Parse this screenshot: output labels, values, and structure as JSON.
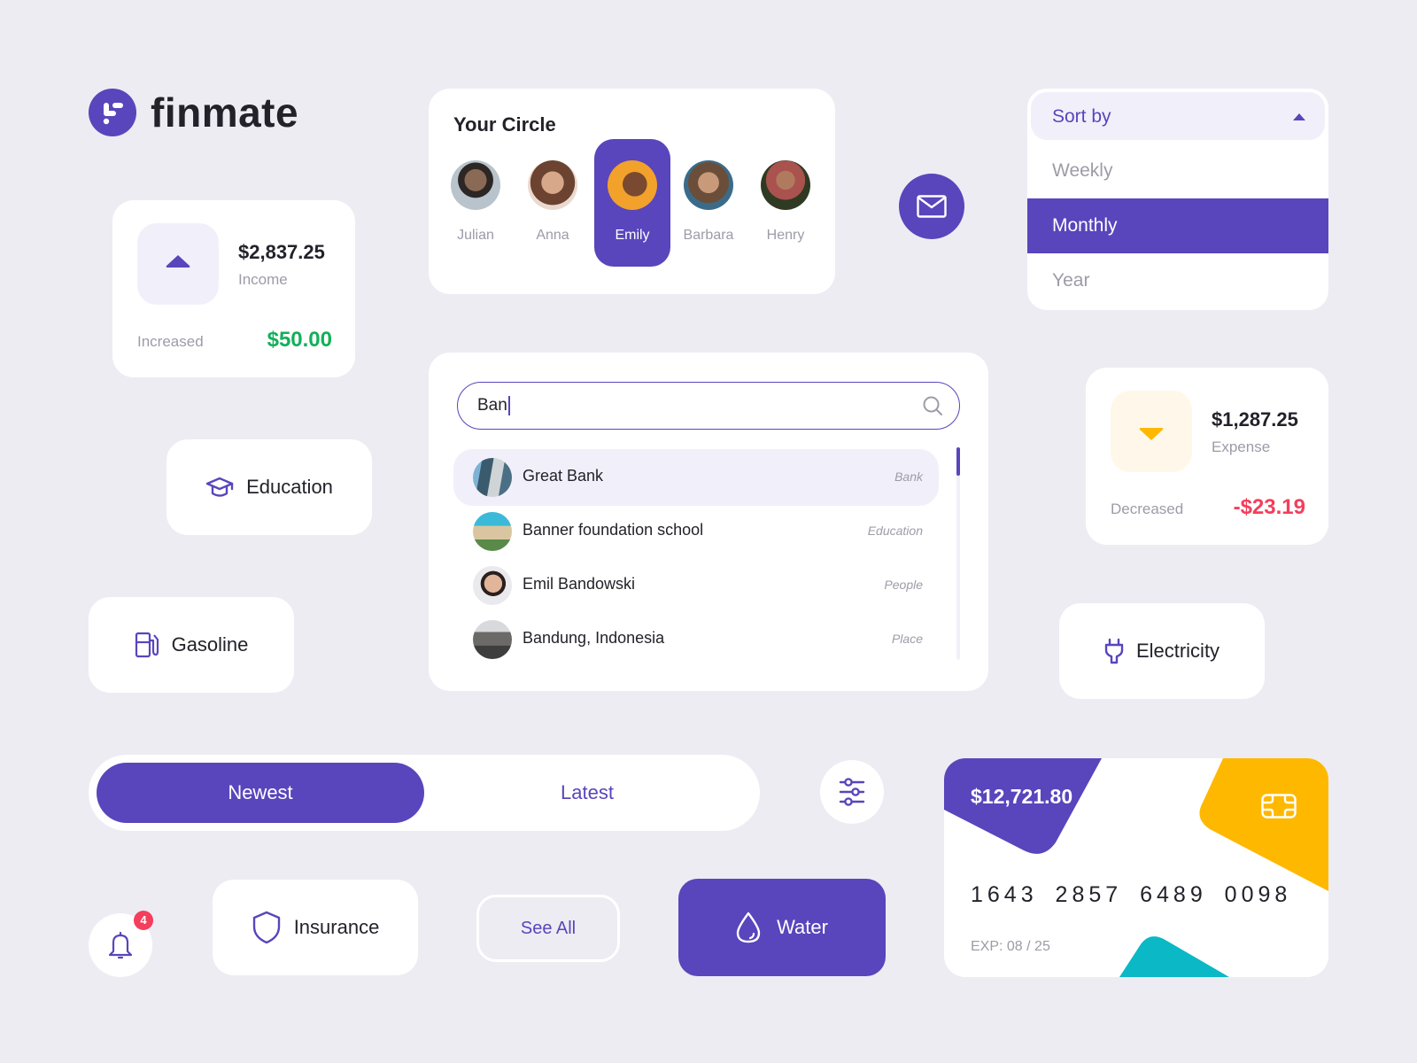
{
  "colors": {
    "primary": "#5945BC",
    "background": "#EDECF3",
    "card": "#FFFFFF",
    "text_dark": "#23222A",
    "text_muted": "#9C9CA8",
    "success": "#12B05A",
    "danger": "#F43E5C",
    "warning": "#FFB800",
    "teal": "#0BB8C6",
    "light_primary": "#F1F0FA",
    "light_warning": "#FFF8EA"
  },
  "brand": {
    "name": "finmate",
    "logo_icon": "finmate-logo-icon"
  },
  "income_card": {
    "amount": "$2,837.25",
    "label": "Income",
    "change_label": "Increased",
    "change_value": "$50.00",
    "icon": "triangle-up-icon"
  },
  "expense_card": {
    "amount": "$1,287.25",
    "label": "Expense",
    "change_label": "Decreased",
    "change_value": "-$23.19",
    "icon": "triangle-down-icon"
  },
  "circle": {
    "title": "Your Circle",
    "people": [
      {
        "name": "Julian",
        "active": false
      },
      {
        "name": "Anna",
        "active": false
      },
      {
        "name": "Emily",
        "active": true
      },
      {
        "name": "Barbara",
        "active": false
      },
      {
        "name": "Henry",
        "active": false
      }
    ]
  },
  "mail_button": {
    "icon": "mail-icon"
  },
  "sort_dropdown": {
    "label": "Sort by",
    "options": [
      "Weekly",
      "Monthly",
      "Year"
    ],
    "selected": "Monthly",
    "expanded": true
  },
  "search": {
    "value": "Ban",
    "icon": "search-icon",
    "results": [
      {
        "name": "Great Bank",
        "type": "Bank",
        "highlighted": true
      },
      {
        "name": "Banner foundation school",
        "type": "Education",
        "highlighted": false
      },
      {
        "name": "Emil Bandowski",
        "type": "People",
        "highlighted": false
      },
      {
        "name": "Bandung, Indonesia",
        "type": "Place",
        "highlighted": false
      }
    ]
  },
  "categories": {
    "education": {
      "label": "Education",
      "icon": "graduation-cap-icon"
    },
    "gasoline": {
      "label": "Gasoline",
      "icon": "fuel-pump-icon"
    },
    "electricity": {
      "label": "Electricity",
      "icon": "plug-icon"
    },
    "insurance": {
      "label": "Insurance",
      "icon": "shield-icon"
    },
    "water": {
      "label": "Water",
      "icon": "water-drop-icon"
    }
  },
  "segmented": {
    "options": [
      "Newest",
      "Latest"
    ],
    "selected": "Newest"
  },
  "filter_button": {
    "icon": "sliders-icon"
  },
  "notifications": {
    "icon": "bell-icon",
    "count": "4"
  },
  "see_all": {
    "label": "See All"
  },
  "credit_card": {
    "balance": "$12,721.80",
    "number": "1643 2857 6489 0098",
    "expiry": "EXP: 08 / 25",
    "chip_icon": "card-chip-icon"
  }
}
